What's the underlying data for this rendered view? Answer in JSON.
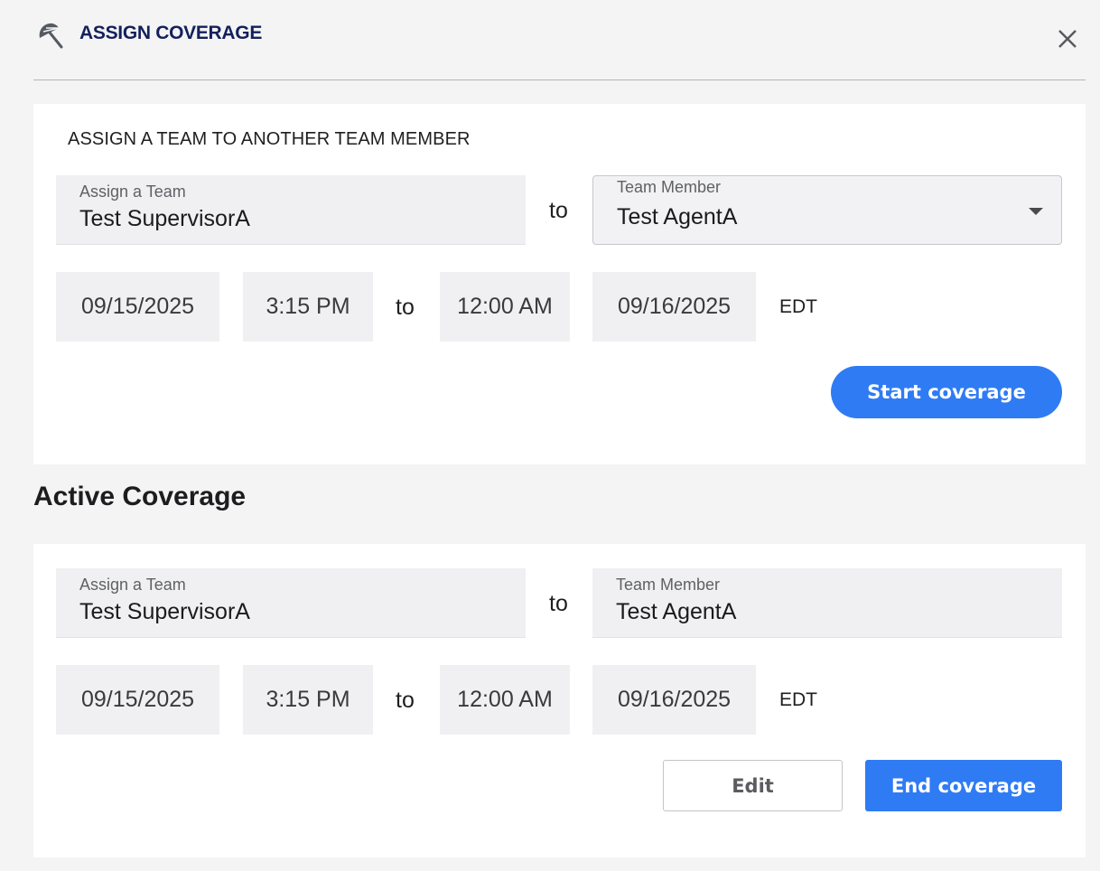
{
  "header": {
    "title": "ASSIGN COVERAGE",
    "icon": "umbrella-icon",
    "close_icon": "close-icon"
  },
  "assign_form": {
    "heading": "ASSIGN A TEAM TO ANOTHER TEAM MEMBER",
    "team_label": "Assign a Team",
    "team_value": "Test SupervisorA",
    "to_text": "to",
    "member_label": "Team Member",
    "member_value": "Test AgentA",
    "start_date": "09/15/2025",
    "start_time": "3:15 PM",
    "range_to_text": "to",
    "end_time": "12:00 AM",
    "end_date": "09/16/2025",
    "timezone": "EDT",
    "start_button": "Start coverage"
  },
  "active": {
    "section_title": "Active Coverage",
    "team_label": "Assign a Team",
    "team_value": "Test SupervisorA",
    "to_text": "to",
    "member_label": "Team Member",
    "member_value": "Test AgentA",
    "start_date": "09/15/2025",
    "start_time": "3:15 PM",
    "range_to_text": "to",
    "end_time": "12:00 AM",
    "end_date": "09/16/2025",
    "timezone": "EDT",
    "edit_button": "Edit",
    "end_button": "End coverage"
  },
  "colors": {
    "primary": "#2f7bf3",
    "title": "#14205c",
    "background": "#f4f4f5"
  }
}
